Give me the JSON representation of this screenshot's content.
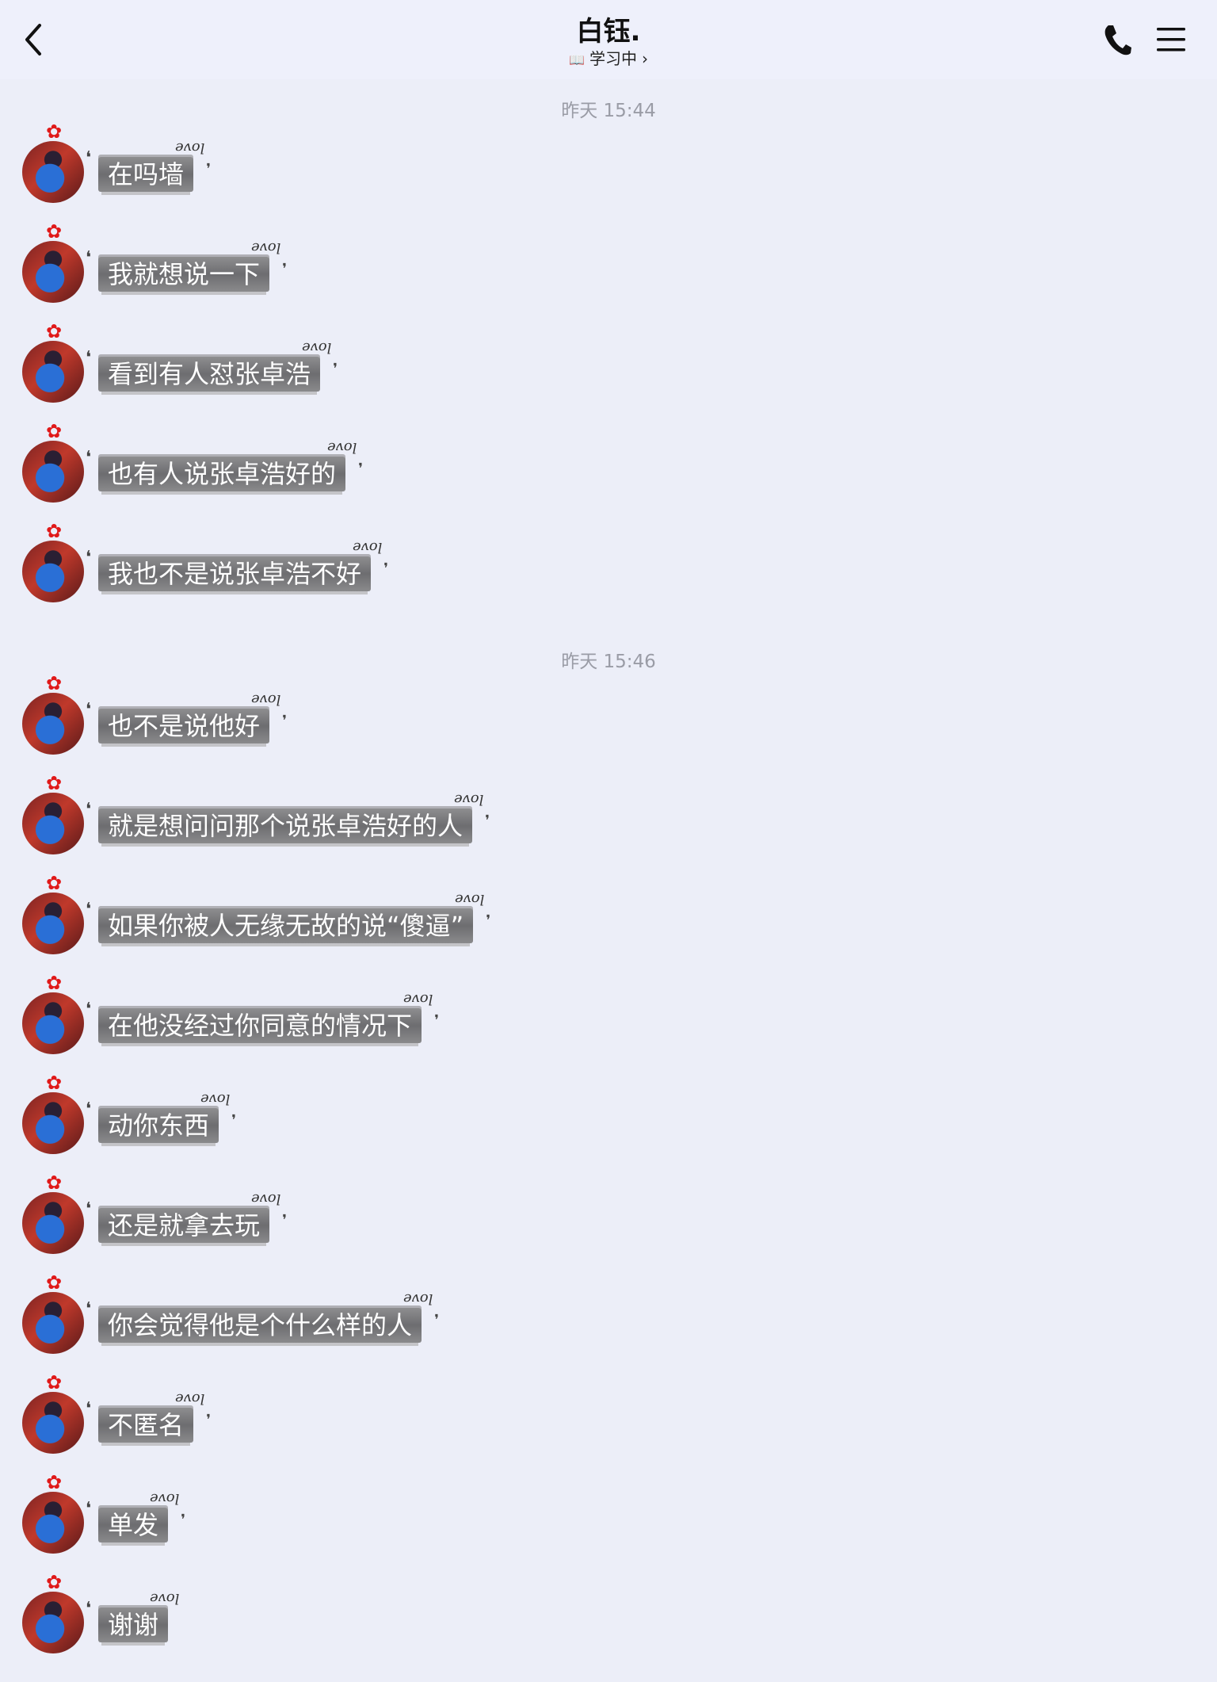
{
  "header": {
    "back_icon": "chevron-left-icon",
    "title": "白钰.",
    "status_icon": "book-icon",
    "status_text": "学习中",
    "call_icon": "phone-icon",
    "menu_icon": "menu-icon"
  },
  "timestamps": [
    "昨天 15:44",
    "昨天 15:46"
  ],
  "messages": [
    {
      "text": "在吗墙"
    },
    {
      "text": "我就想说一下"
    },
    {
      "text": "看到有人怼张卓浩"
    },
    {
      "text": "也有人说张卓浩好的"
    },
    {
      "text": "我也不是说张卓浩不好"
    },
    {
      "text": "也不是说他好"
    },
    {
      "text": "就是想问问那个说张卓浩好的人"
    },
    {
      "text": "如果你被人无缘无故的说“傻逼”"
    },
    {
      "text": "在他没经过你同意的情况下"
    },
    {
      "text": "动你东西"
    },
    {
      "text": "还是就拿去玩"
    },
    {
      "text": "你会觉得他是个什么样的人"
    },
    {
      "text": "不匿名"
    },
    {
      "text": "单发"
    },
    {
      "text": "谢谢"
    }
  ],
  "bubble_decoration": "love"
}
